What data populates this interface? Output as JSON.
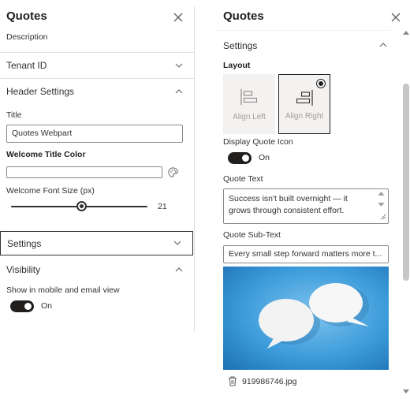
{
  "left": {
    "title": "Quotes",
    "description": "Description",
    "sections": {
      "tenant": "Tenant ID",
      "header": "Header Settings",
      "settings": "Settings",
      "visibility": "Visibility"
    },
    "title_field": {
      "label": "Title",
      "value": "Quotes Webpart"
    },
    "color_field": {
      "label": "Welcome Title Color",
      "value": ""
    },
    "font_size": {
      "label": "Welcome Font Size (px)",
      "value": "21",
      "level": 0.52
    },
    "mobile_view": {
      "label": "Show in mobile and email view",
      "state": "On"
    }
  },
  "right": {
    "title": "Quotes",
    "settings_section": "Settings",
    "layout": {
      "label": "Layout",
      "options": [
        {
          "label": "Align Left",
          "selected": false
        },
        {
          "label": "Align Right",
          "selected": true
        }
      ]
    },
    "quote_icon": {
      "label": "Display Quote Icon",
      "state": "On"
    },
    "quote_text": {
      "label": "Quote Text",
      "line1": "Success isn't built overnight — it",
      "line2": "grows through consistent effort."
    },
    "quote_subtext": {
      "label": "Quote Sub-Text",
      "value": "Every small step forward matters more t..."
    },
    "image": {
      "filename": "919986746.jpg"
    }
  },
  "colors": {
    "accent": "#201f1e",
    "border": "#8a8886",
    "divider": "#e1dfdd",
    "image_bg": "#3a9ad9"
  }
}
